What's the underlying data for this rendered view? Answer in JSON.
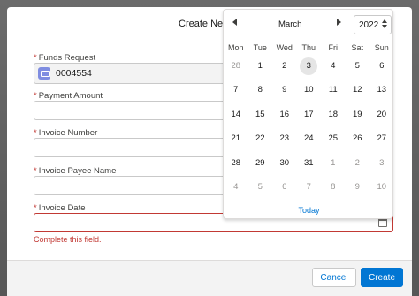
{
  "modal": {
    "title": "Create Ne"
  },
  "fields": {
    "funds_request": {
      "label": "Funds Request",
      "value": "0004554"
    },
    "payment_amount": {
      "label": "Payment Amount",
      "value": ""
    },
    "invoice_number": {
      "label": "Invoice Number",
      "value": ""
    },
    "invoice_payee_name": {
      "label": "Invoice Payee Name",
      "value": ""
    },
    "invoice_date": {
      "label": "Invoice Date",
      "value": "",
      "error": "Complete this field."
    }
  },
  "required_marker": "*",
  "datepicker": {
    "month": "March",
    "year": "2022",
    "weekdays": [
      "Mon",
      "Tue",
      "Wed",
      "Thu",
      "Fri",
      "Sat",
      "Sun"
    ],
    "weeks": [
      [
        "28",
        "1",
        "2",
        "3",
        "4",
        "5",
        "6"
      ],
      [
        "7",
        "8",
        "9",
        "10",
        "11",
        "12",
        "13"
      ],
      [
        "14",
        "15",
        "16",
        "17",
        "18",
        "19",
        "20"
      ],
      [
        "21",
        "22",
        "23",
        "24",
        "25",
        "26",
        "27"
      ],
      [
        "28",
        "29",
        "30",
        "31",
        "1",
        "2",
        "3"
      ],
      [
        "4",
        "5",
        "6",
        "7",
        "8",
        "9",
        "10"
      ]
    ],
    "highlighted_day": "3",
    "today_label": "Today"
  },
  "footer": {
    "cancel_label": "Cancel",
    "create_label": "Create"
  },
  "colors": {
    "brand": "#0176d3",
    "error": "#c23934",
    "today_bg": "#e5e5e5"
  },
  "icons": {
    "lookup": "funds-request-record-icon",
    "calendar": "calendar-icon",
    "prev": "left-triangle",
    "next": "right-triangle"
  }
}
